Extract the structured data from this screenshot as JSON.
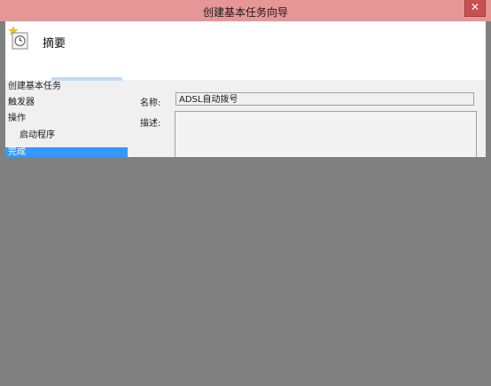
{
  "window": {
    "title": "创建基本任务向导",
    "close_label": "✕"
  },
  "header": {
    "title": "摘要",
    "icon": "task-scheduler-clock-icon"
  },
  "nav": {
    "items": [
      {
        "label": "创建基本任务",
        "indent": false,
        "selected": false
      },
      {
        "label": "触发器",
        "indent": false,
        "selected": false
      },
      {
        "label": "操作",
        "indent": false,
        "selected": false
      },
      {
        "label": "启动程序",
        "indent": true,
        "selected": false
      },
      {
        "label": "完成",
        "indent": false,
        "selected": true
      }
    ]
  },
  "form": {
    "name_label": "名称:",
    "name_value": "ADSL自动拨号",
    "desc_label": "描述:",
    "desc_value": ""
  },
  "colors": {
    "titlebar": "#e69696",
    "selection": "#3399ff",
    "overlay": "#808080"
  }
}
